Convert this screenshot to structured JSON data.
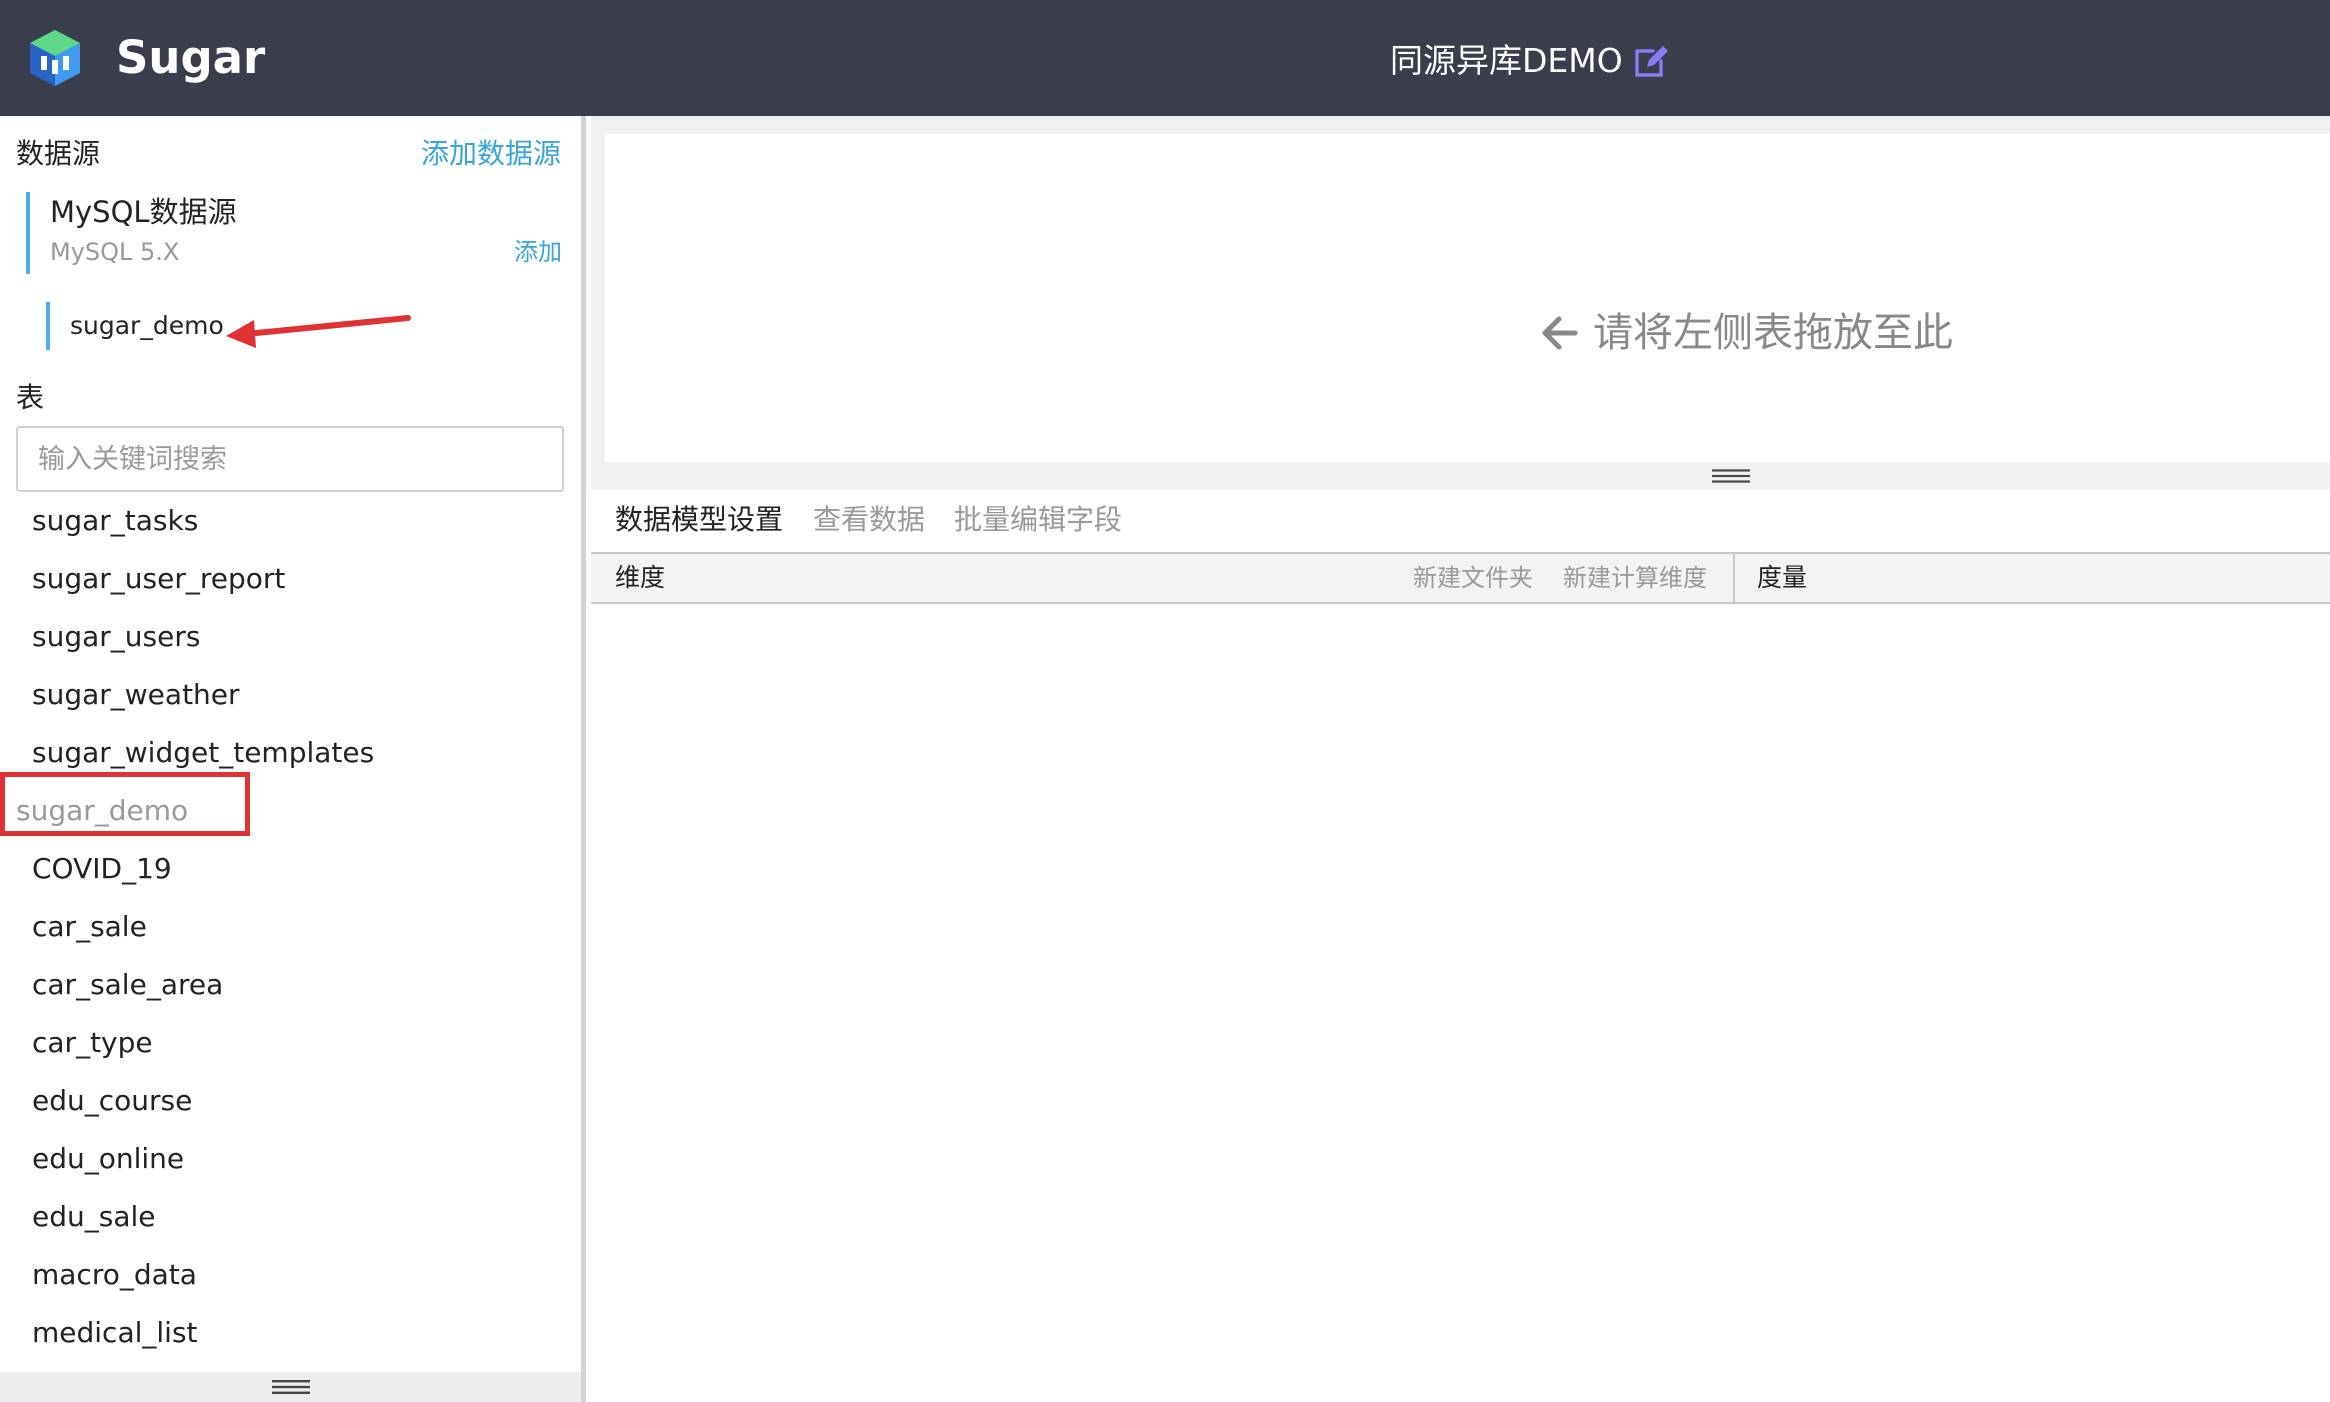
{
  "header": {
    "brand": "Sugar",
    "title": "同源异库DEMO"
  },
  "sidebar": {
    "datasource_label": "数据源",
    "add_datasource": "添加数据源",
    "source": {
      "name": "MySQL数据源",
      "version": "MySQL 5.X",
      "add_label": "添加"
    },
    "database": "sugar_demo",
    "tables_label": "表",
    "search_placeholder": "输入关键词搜索",
    "tables": [
      "sugar_tasks",
      "sugar_user_report",
      "sugar_users",
      "sugar_weather",
      "sugar_widget_templates",
      "sugar_demo",
      "COVID_19",
      "car_sale",
      "car_sale_area",
      "car_type",
      "edu_course",
      "edu_online",
      "edu_sale",
      "macro_data",
      "medical_list"
    ]
  },
  "main": {
    "drop_hint": "请将左侧表拖放至此",
    "tabs": [
      "数据模型设置",
      "查看数据",
      "批量编辑字段"
    ],
    "fields": {
      "dimension_label": "维度",
      "new_folder": "新建文件夹",
      "new_calc_dimension": "新建计算维度",
      "measure_label": "度量"
    }
  },
  "colors": {
    "header_bg": "#393d4c",
    "accent": "#36a5dc",
    "annotation_red": "#e03232",
    "edit_icon": "#8b7cf6"
  }
}
